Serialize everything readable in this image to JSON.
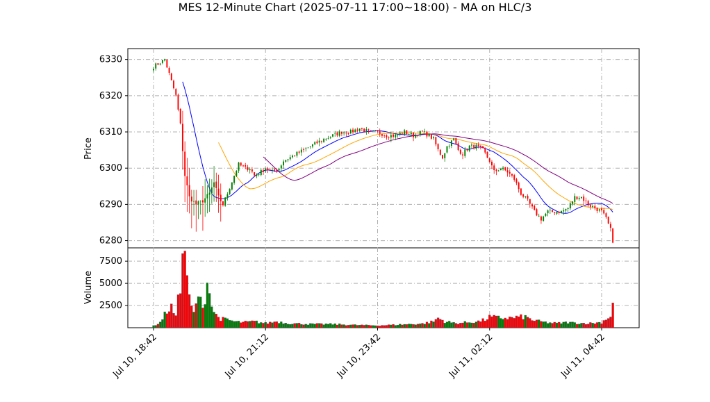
{
  "chart_data": {
    "type": "candlestick",
    "title": "MES 12-Minute Chart (2025-07-11 17:00~18:00) - MA on HLC/3",
    "price_panel": {
      "ylabel": "Price",
      "ylim": [
        6278,
        6333
      ],
      "yticks": [
        6280,
        6290,
        6300,
        6310,
        6320,
        6330
      ]
    },
    "volume_panel": {
      "ylabel": "Volume",
      "ylim": [
        0,
        9000
      ],
      "yticks": [
        2500,
        5000,
        7500
      ]
    },
    "x_ticks": [
      {
        "index": 0,
        "label": "Jul 10, 18:42"
      },
      {
        "index": 50,
        "label": "Jul 10, 21:12"
      },
      {
        "index": 100,
        "label": "Jul 10, 23:42"
      },
      {
        "index": 150,
        "label": "Jul 11, 02:12"
      },
      {
        "index": 200,
        "label": "Jul 11, 04:42"
      }
    ],
    "grid": true,
    "up_color": "#008000",
    "down_color": "#ff0000",
    "ma_colors": [
      "#0000ff",
      "#ffa500",
      "#800080"
    ],
    "series_note": "candles: o,h,l,c; volume per bar; three moving averages"
  }
}
